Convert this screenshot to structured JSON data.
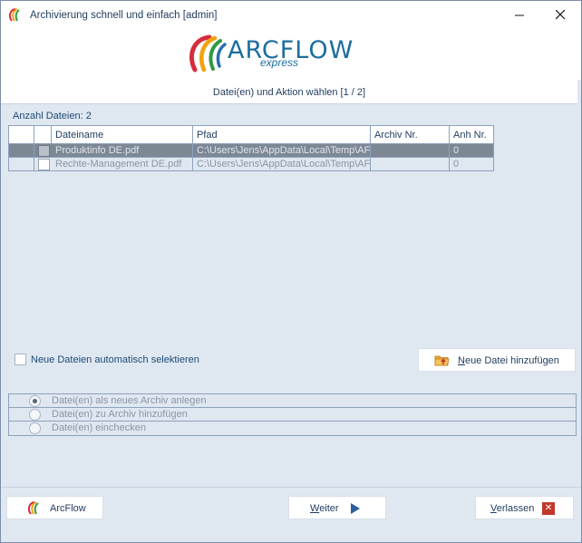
{
  "window": {
    "title": "Archivierung schnell und einfach  [admin]",
    "minimize_icon": "minimize-icon",
    "close_icon": "close-icon"
  },
  "logo": {
    "word": "ARCFLOW",
    "sub": "express"
  },
  "step": {
    "text": "Datei(en) und Aktion wählen   [1 / 2]"
  },
  "files": {
    "count_label": "Anzahl Dateien: 2",
    "columns": [
      "Dateiname",
      "Pfad",
      "Archiv Nr.",
      "Anh Nr."
    ],
    "rows": [
      {
        "name": "Produktinfo DE.pdf",
        "path": "C:\\Users\\Jens\\AppData\\Local\\Temp\\AF",
        "archive": "",
        "attachment": "0",
        "selected": true
      },
      {
        "name": "Rechte-Management DE.pdf",
        "path": "C:\\Users\\Jens\\AppData\\Local\\Temp\\AF",
        "archive": "",
        "attachment": "0",
        "selected": false
      }
    ]
  },
  "auto_select_label": "Neue Dateien automatisch selektieren",
  "add_file_button": {
    "first": "N",
    "rest": "eue Datei hinzufügen",
    "icon": "folder-add-icon"
  },
  "actions": [
    {
      "label": "Datei(en) als neues Archiv anlegen",
      "checked": true
    },
    {
      "label": "Datei(en) zu Archiv hinzufügen",
      "checked": false
    },
    {
      "label": "Datei(en) einchecken",
      "checked": false
    }
  ],
  "footer": {
    "arcflow_label": "ArcFlow",
    "next_first": "W",
    "next_rest": "eiter",
    "exit_first": "V",
    "exit_rest": "erlassen",
    "colors": {
      "exit_icon": "#c0392b",
      "next_icon": "#2b5f9e"
    }
  }
}
